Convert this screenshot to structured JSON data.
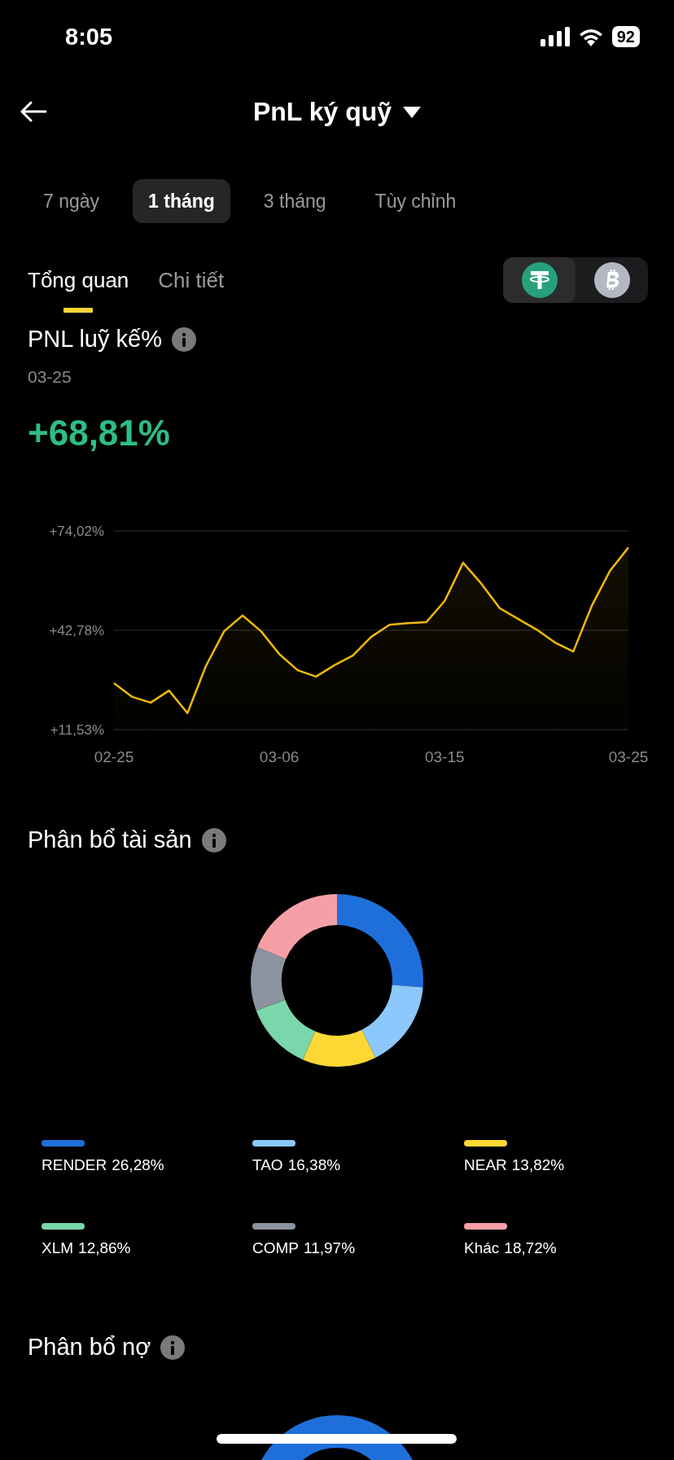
{
  "status_bar": {
    "time": "8:05",
    "battery": "92"
  },
  "header": {
    "title": "PnL ký quỹ"
  },
  "periods": [
    {
      "label": "7 ngày",
      "selected": false
    },
    {
      "label": "1 tháng",
      "selected": true
    },
    {
      "label": "3 tháng",
      "selected": false
    },
    {
      "label": "Tùy chỉnh",
      "selected": false
    }
  ],
  "view_tabs": [
    {
      "label": "Tổng quan",
      "selected": true
    },
    {
      "label": "Chi tiết",
      "selected": false
    }
  ],
  "currency_toggle": [
    {
      "kind": "usdt",
      "selected": true
    },
    {
      "kind": "btc",
      "selected": false
    }
  ],
  "pnl": {
    "title": "PNL luỹ kế%",
    "date": "03-25",
    "value": "+68,81%",
    "chart_data": {
      "type": "area",
      "categories": [
        "02-25",
        null,
        null,
        null,
        null,
        null,
        null,
        null,
        null,
        "03-06",
        null,
        null,
        null,
        null,
        null,
        null,
        null,
        null,
        "03-15",
        null,
        null,
        null,
        null,
        null,
        null,
        null,
        null,
        null,
        "03-25"
      ],
      "series": [
        {
          "color": "#f0b90b",
          "values": [
            26.1,
            21.8,
            20.0,
            23.8,
            16.7,
            31.5,
            42.5,
            47.4,
            42.5,
            35.3,
            30.2,
            28.2,
            31.8,
            34.8,
            40.7,
            44.5,
            45.0,
            45.3,
            52.0,
            64.0,
            57.4,
            49.7,
            46.3,
            43.0,
            38.9,
            36.1,
            50.4,
            61.5,
            68.8
          ]
        }
      ],
      "ylim": [
        11.53,
        74.02
      ],
      "yticks": [
        {
          "value": 74.02,
          "label": "+74,02%"
        },
        {
          "value": 42.78,
          "label": "+42,78%"
        },
        {
          "value": 11.53,
          "label": "+11,53%"
        }
      ]
    }
  },
  "allocation": {
    "title": "Phân bổ tài sản",
    "chart_data": {
      "type": "donut",
      "categories": [
        "RENDER",
        "TAO",
        "NEAR",
        "XLM",
        "COMP",
        "Khác"
      ],
      "values": [
        26.28,
        16.38,
        13.82,
        12.86,
        11.97,
        18.72
      ]
    },
    "legend": [
      {
        "percent": "26,28%",
        "color": "#1f6fdb"
      },
      {
        "percent": "16,38%",
        "color": "#8cc8fb"
      },
      {
        "percent": "13,82%",
        "color": "#fdd835"
      },
      {
        "percent": "12,86%",
        "color": "#7ad6ab"
      },
      {
        "percent": "11,97%",
        "color": "#8a939f"
      },
      {
        "percent": "18,72%",
        "color": "#f5a0a6"
      }
    ]
  },
  "debt": {
    "title": "Phân bổ nợ"
  }
}
